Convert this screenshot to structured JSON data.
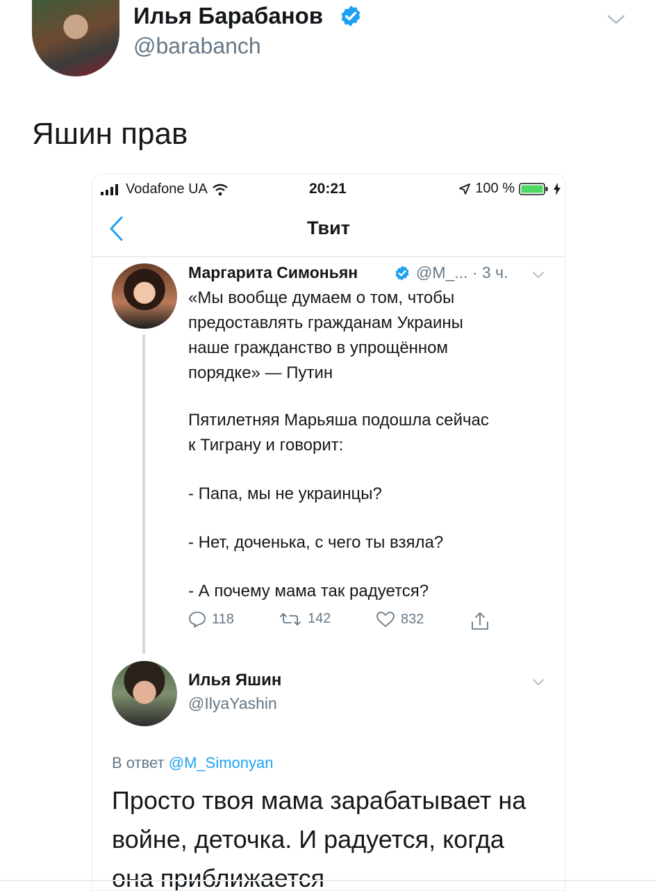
{
  "outer_tweet": {
    "author_name": "Илья Барабанов",
    "author_handle": "@barabanch",
    "text": "Яшин прав"
  },
  "phone": {
    "status": {
      "carrier": "Vodafone UA",
      "time": "20:21",
      "battery": "100 %"
    },
    "nav": {
      "title": "Твит"
    },
    "quoted_tweet": {
      "author_name": "Маргарита Симоньян",
      "author_handle": "@M_...",
      "time": "· 3 ч.",
      "lines": [
        "«Мы вообще думаем о том, чтобы",
        "предоставлять гражданам Украины",
        "наше гражданство в упрощённом",
        "порядке» — Путин",
        "Пятилетняя Марьяша подошла сейчас",
        "к Тиграну и говорит:",
        "- Папа, мы не украинцы?",
        "- Нет, доченька, с чего ты взяла?",
        "- А почему мама так радуется?"
      ],
      "counts": {
        "replies": "118",
        "retweets": "142",
        "likes": "832"
      }
    },
    "reply_tweet": {
      "author_name": "Илья Яшин",
      "author_handle": "@IlyaYashin",
      "reply_prefix": "В ответ",
      "reply_mention": "@M_Simonyan",
      "lines": [
        "Просто твоя мама зарабатывает на",
        "войне, деточка. И радуется, когда",
        "она приближается"
      ]
    }
  },
  "colors": {
    "accent": "#1da1f2",
    "muted": "#657786",
    "text": "#14171a"
  }
}
